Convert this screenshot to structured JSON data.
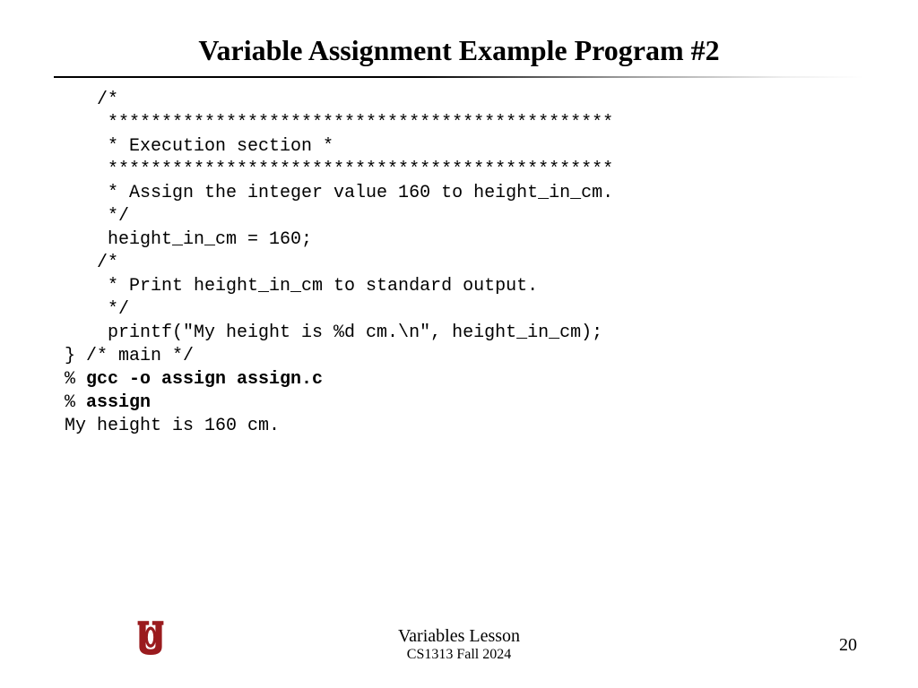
{
  "title": "Variable Assignment Example Program #2",
  "code": {
    "l1": "   /*",
    "l2": "    ***********************************************",
    "l3": "    * Execution section *",
    "l4": "    ***********************************************",
    "l5": "    * Assign the integer value 160 to height_in_cm.",
    "l6": "    */",
    "l7": "    height_in_cm = 160;",
    "l8": "   /*",
    "l9": "    * Print height_in_cm to standard output.",
    "l10": "    */",
    "l11": "    printf(\"My height is %d cm.\\n\", height_in_cm);",
    "l12": "} /* main */",
    "l13a": "% ",
    "l13b": "gcc -o assign assign.c",
    "l14a": "% ",
    "l14b": "assign",
    "l15": "My height is 160 cm."
  },
  "footer": {
    "lesson": "Variables Lesson",
    "course": "CS1313 Fall 2024",
    "page": "20"
  }
}
